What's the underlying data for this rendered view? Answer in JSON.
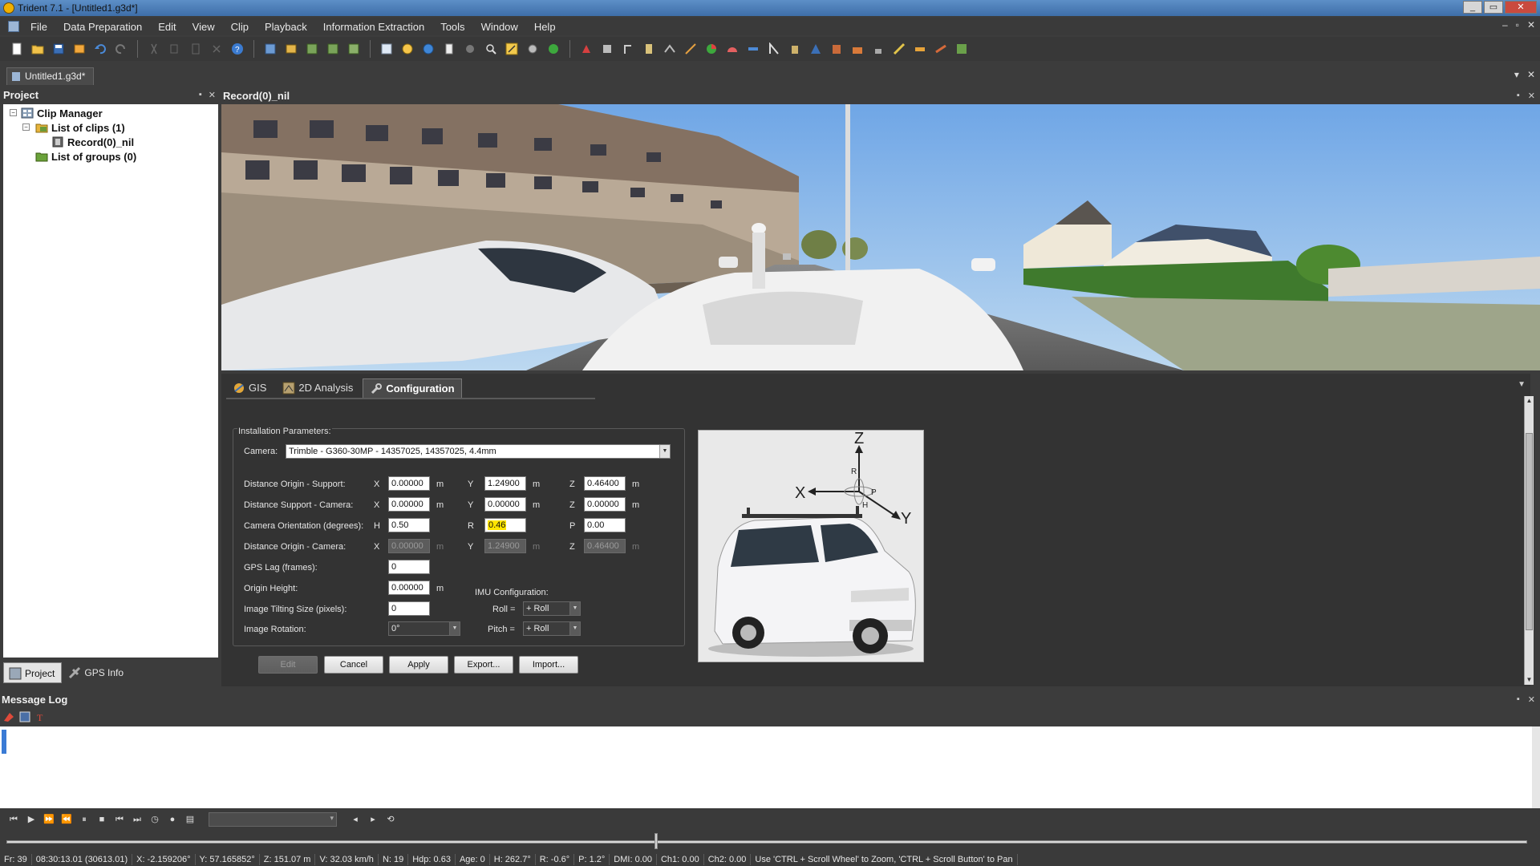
{
  "window": {
    "title": "Trident 7.1 - [Untitled1.g3d*]",
    "controls": [
      "_",
      "▭",
      "✕"
    ]
  },
  "menubar": {
    "items": [
      "File",
      "Data Preparation",
      "Edit",
      "View",
      "Clip",
      "Playback",
      "Information Extraction",
      "Tools",
      "Window",
      "Help"
    ],
    "mdi_controls": [
      "–",
      "▫",
      "✕"
    ]
  },
  "toolbar": {
    "icons": [
      "new-icon",
      "open-icon",
      "save-icon",
      "save-as-icon",
      "undo-icon",
      "redo-icon",
      "cut-icon",
      "copy-icon",
      "paste-icon",
      "delete-icon",
      "help-icon",
      "layout-icon",
      "clip-icon",
      "grid-icon",
      "grid2-icon",
      "grid3-icon",
      "select-icon",
      "pan-icon",
      "globe-icon",
      "page-icon",
      "sphere-icon",
      "zoom-icon",
      "measure-icon",
      "target-icon",
      "green-sphere-icon",
      "marker-icon",
      "tool1-icon",
      "tool2-icon",
      "tool3-icon",
      "tool4-icon",
      "tool5-icon",
      "pie-icon",
      "chart-icon",
      "ruler-icon",
      "tool6-icon",
      "tool7-icon",
      "tool8-icon",
      "tool9-icon",
      "tool10-icon",
      "tool11-icon",
      "tool12-icon",
      "tool13-icon",
      "tool14-icon",
      "tool15-icon",
      "tool16-icon"
    ]
  },
  "doc_tab": {
    "label": "Untitled1.g3d*"
  },
  "project_panel": {
    "title": "Project",
    "tree": {
      "root": "Clip Manager",
      "clips": "List of clips (1)",
      "record": "Record(0)_nil",
      "groups": "List of groups (0)"
    },
    "tabs": [
      "Project",
      "GPS Info"
    ]
  },
  "record_view": {
    "title": "Record(0)_nil"
  },
  "config_tabs": [
    "GIS",
    "2D Analysis",
    "Configuration"
  ],
  "installation": {
    "legend": "Installation Parameters:",
    "camera_label": "Camera:",
    "camera_value": "Trimble - G360-30MP - 14357025, 14357025, 4.4mm",
    "rows": {
      "origin_support": {
        "label": "Distance Origin - Support:",
        "x": "0.00000",
        "y": "1.24900",
        "z": "0.46400"
      },
      "support_camera": {
        "label": "Distance Support - Camera:",
        "x": "0.00000",
        "y": "0.00000",
        "z": "0.00000"
      },
      "camera_orientation": {
        "label": "Camera Orientation (degrees):",
        "h": "0.50",
        "r": "0.46",
        "p": "0.00"
      },
      "origin_camera": {
        "label": "Distance Origin - Camera:",
        "x": "0.00000",
        "y": "1.24900",
        "z": "0.46400"
      }
    },
    "axes": {
      "x": "X",
      "y": "Y",
      "z": "Z",
      "h": "H",
      "r": "R",
      "p": "P"
    },
    "unit_m": "m",
    "gps_lag": {
      "label": "GPS Lag (frames):",
      "value": "0"
    },
    "origin_height": {
      "label": "Origin Height:",
      "value": "0.00000"
    },
    "image_tilting": {
      "label": "Image Tilting Size (pixels):",
      "value": "0"
    },
    "image_rotation": {
      "label": "Image Rotation:",
      "value": "0°"
    },
    "imu": {
      "title": "IMU Configuration:",
      "roll_label": "Roll =",
      "roll_value": "+ Roll",
      "pitch_label": "Pitch =",
      "pitch_value": "+ Roll"
    },
    "diagram_axes": {
      "z": "Z",
      "x": "X",
      "y": "Y",
      "r": "R",
      "p": "P",
      "h": "H"
    }
  },
  "buttons": {
    "edit": "Edit",
    "cancel": "Cancel",
    "apply": "Apply",
    "export": "Export...",
    "import": "Import..."
  },
  "message_log": {
    "title": "Message Log"
  },
  "status": {
    "fr": "Fr:  39",
    "time": "08:30:13.01  (30613.01)",
    "x": "X: -2.159206°",
    "y": "Y: 57.165852°",
    "z": "Z: 151.07 m",
    "v": "V: 32.03 km/h",
    "n": "N: 19",
    "hdp": "Hdp: 0.63",
    "age": "Age: 0",
    "h": "H: 262.7°",
    "r": "R: -0.6°",
    "p": "P: 1.2°",
    "dmi": "DMI:  0.00",
    "ch1": "Ch1:  0.00",
    "ch2": "Ch2:  0.00",
    "hint": "Use 'CTRL + Scroll Wheel' to Zoom, 'CTRL + Scroll Button' to Pan"
  }
}
